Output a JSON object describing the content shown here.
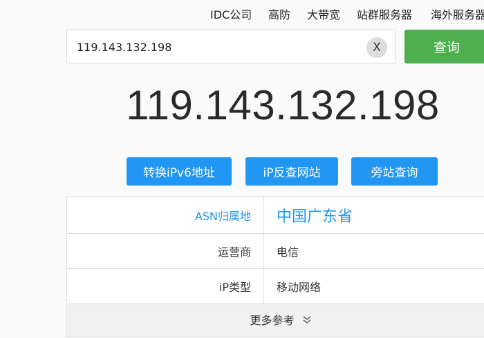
{
  "nav": {
    "items": [
      "IDC公司",
      "高防",
      "大带宽",
      "站群服务器",
      "海外服务器"
    ]
  },
  "search": {
    "value": "119.143.132.198",
    "clear_label": "X",
    "button_label": "查询"
  },
  "result": {
    "ip": "119.143.132.198"
  },
  "actions": {
    "convert_ipv6": "转换iPv6地址",
    "reverse_lookup": "iP反查网站",
    "neighbor_lookup": "旁站查询"
  },
  "info": {
    "rows": [
      {
        "label": "ASN归属地",
        "value": "中国广东省"
      },
      {
        "label": "运营商",
        "value": "电信"
      },
      {
        "label": "iP类型",
        "value": "移动网络"
      }
    ],
    "more_label": "更多参考"
  },
  "colors": {
    "primary_blue": "#2196f3",
    "query_green": "#4cae4c"
  }
}
